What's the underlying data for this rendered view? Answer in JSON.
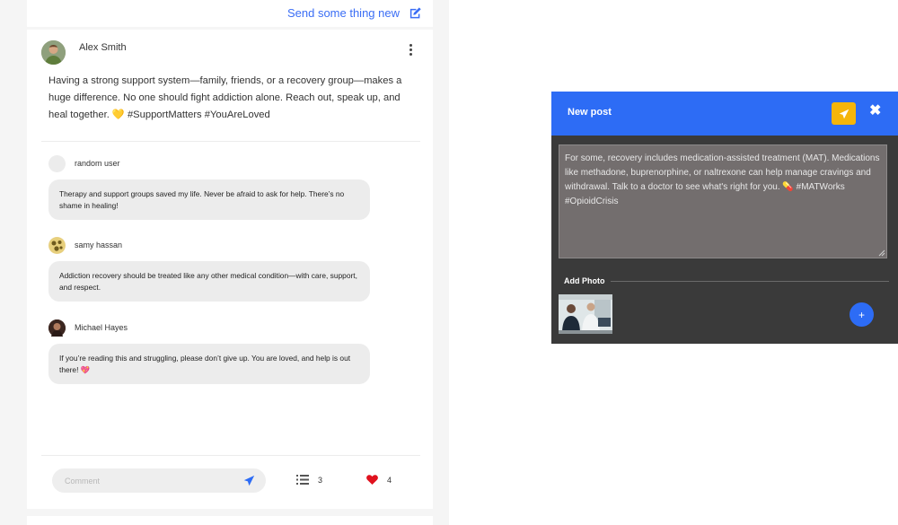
{
  "header": {
    "send_new_label": "Send some thing new"
  },
  "post": {
    "author": "Alex Smith",
    "text": "Having a strong support system—family, friends, or a recovery group—makes a huge difference. No one should fight addiction alone. Reach out, speak up, and heal together. 💛 #SupportMatters #YouAreLoved",
    "comments": [
      {
        "name": "random user",
        "text": "Therapy and support groups saved my life. Never be afraid to ask for help. There’s no shame in healing!"
      },
      {
        "name": "samy hassan",
        "text": "Addiction recovery should be treated like any other medical condition—with care, support, and respect."
      },
      {
        "name": "Michael Hayes",
        "text": "If you’re reading this and struggling, please don’t give up. You are loved, and help is out there! 💖"
      }
    ],
    "comment_placeholder": "Comment",
    "comment_count": "3",
    "like_count": "4"
  },
  "modal": {
    "title": "New post",
    "textarea_value": "For some, recovery includes medication-assisted treatment (MAT). Medications like methadone, buprenorphine, or naltrexone can help manage cravings and withdrawal. Talk to a doctor to see what's right for you. 💊 #MATWorks #OpioidCrisis",
    "add_photo_label": "Add Photo",
    "close_label": "✖",
    "add_label": "+"
  },
  "colors": {
    "accent": "#2d6cf5",
    "post_button": "#f5b50a",
    "like": "#e0121e",
    "link": "#3b6ef5"
  }
}
